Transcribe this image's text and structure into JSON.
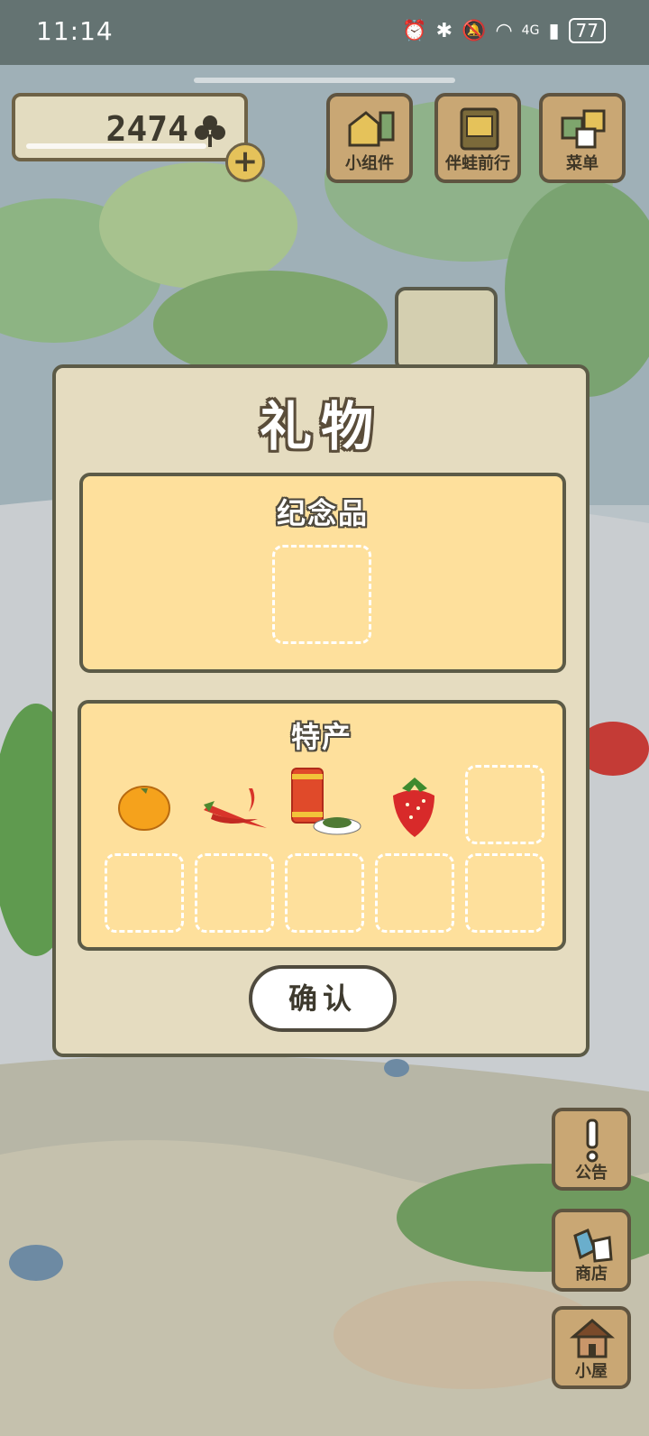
{
  "status_bar": {
    "time": "11:14",
    "battery": "77",
    "network": "4G"
  },
  "currency": {
    "value": "2474",
    "icon": "clover-icon"
  },
  "top_menu": [
    {
      "label": "小组件",
      "icon": "widget-icon"
    },
    {
      "label": "伴蛙前行",
      "icon": "album-icon"
    },
    {
      "label": "菜单",
      "icon": "menu-icon"
    }
  ],
  "side_menu": [
    {
      "label": "公告",
      "icon": "exclamation-icon"
    },
    {
      "label": "商店",
      "icon": "bag-icon"
    },
    {
      "label": "小屋",
      "icon": "house-icon"
    }
  ],
  "dialog": {
    "title": "礼物",
    "souvenir_title": "纪念品",
    "specialty_title": "特产",
    "specialty_items": [
      "orange",
      "chili-peppers",
      "tea-can",
      "strawberry"
    ],
    "confirm_label": "确认"
  },
  "colors": {
    "panel": "#fee09c",
    "dialog": "#e5dcc0",
    "border": "#5c5b47",
    "wood": "#c9a774"
  }
}
